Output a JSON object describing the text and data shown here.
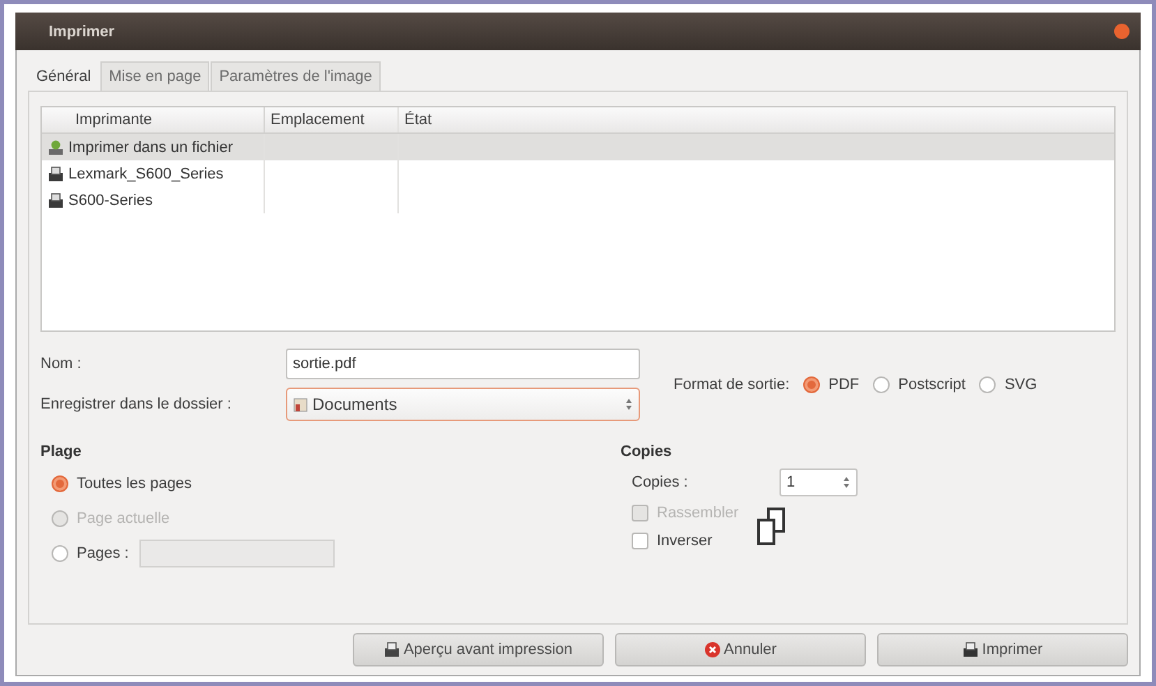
{
  "window": {
    "title": "Imprimer"
  },
  "tabs": [
    {
      "label": "Général",
      "selected": true
    },
    {
      "label": "Mise en page",
      "selected": false
    },
    {
      "label": "Paramètres de l'image",
      "selected": false
    }
  ],
  "printers": {
    "columns": [
      "Imprimante",
      "Emplacement",
      "État"
    ],
    "rows": [
      {
        "name": "Imprimer dans un fichier",
        "kind": "file",
        "selected": true
      },
      {
        "name": "Lexmark_S600_Series",
        "kind": "printer",
        "selected": false
      },
      {
        "name": "S600-Series",
        "kind": "printer",
        "selected": false
      }
    ]
  },
  "name": {
    "label": "Nom :",
    "value": "sortie.pdf"
  },
  "folder": {
    "label": "Enregistrer dans le dossier :",
    "value": "Documents"
  },
  "output_format": {
    "label": "Format de sortie:",
    "options": [
      {
        "label": "PDF",
        "selected": true
      },
      {
        "label": "Postscript",
        "selected": false
      },
      {
        "label": "SVG",
        "selected": false
      }
    ]
  },
  "range": {
    "title": "Plage",
    "options": [
      {
        "label": "Toutes les pages",
        "kind": "radio",
        "selected": true,
        "disabled": false
      },
      {
        "label": "Page actuelle",
        "kind": "radio",
        "selected": false,
        "disabled": true
      },
      {
        "label": "Pages :",
        "kind": "radio_entry",
        "selected": false,
        "disabled": false
      }
    ]
  },
  "copies": {
    "title": "Copies",
    "label": "Copies :",
    "value": "1",
    "checks": [
      {
        "label": "Rassembler",
        "checked": false,
        "disabled": true
      },
      {
        "label": "Inverser",
        "checked": false,
        "disabled": false
      }
    ]
  },
  "buttons": [
    {
      "label": "Aperçu avant impression",
      "kind": "preview"
    },
    {
      "label": "Annuler",
      "kind": "cancel"
    },
    {
      "label": "Imprimer",
      "kind": "print"
    }
  ]
}
